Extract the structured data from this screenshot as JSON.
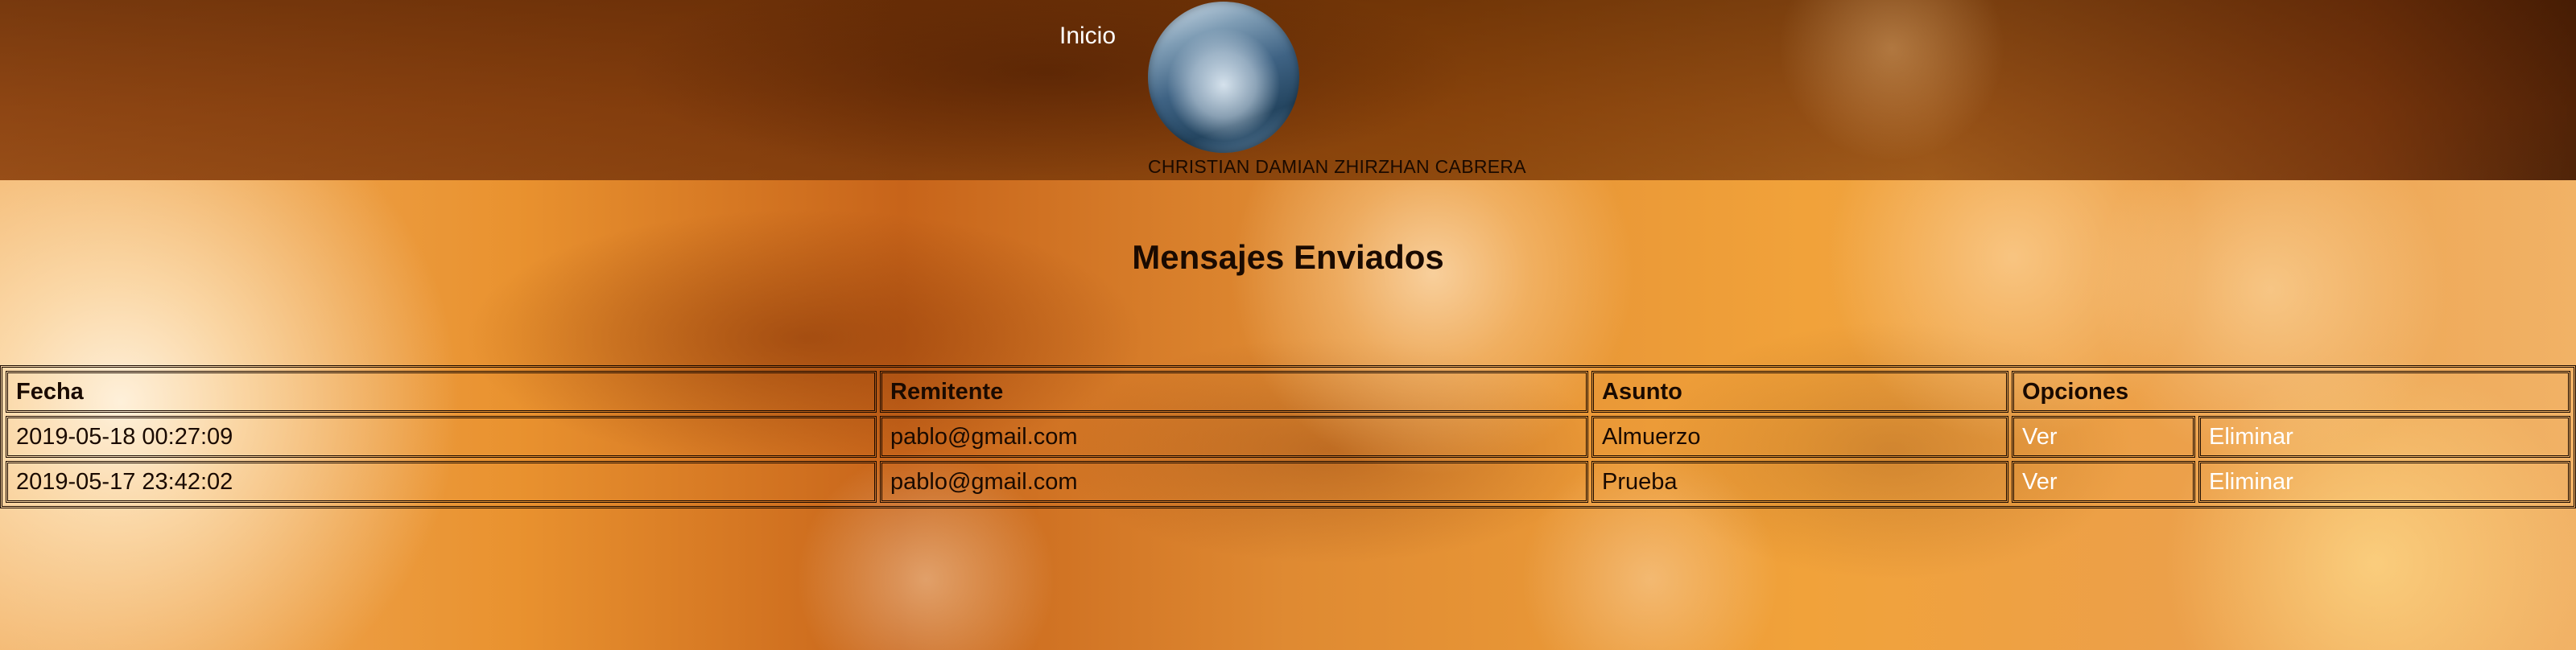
{
  "nav": {
    "home_label": "Inicio"
  },
  "user": {
    "name": "CHRISTIAN DAMIAN ZHIRZHAN CABRERA"
  },
  "page": {
    "title": "Mensajes Enviados"
  },
  "table": {
    "headers": {
      "date": "Fecha",
      "sender": "Remitente",
      "subject": "Asunto",
      "options": "Opciones"
    },
    "rows": [
      {
        "date": "2019-05-18 00:27:09",
        "sender": "pablo@gmail.com",
        "subject": "Almuerzo",
        "view": "Ver",
        "delete": "Eliminar"
      },
      {
        "date": "2019-05-17 23:42:02",
        "sender": "pablo@gmail.com",
        "subject": "Prueba",
        "view": "Ver",
        "delete": "Eliminar"
      }
    ]
  }
}
